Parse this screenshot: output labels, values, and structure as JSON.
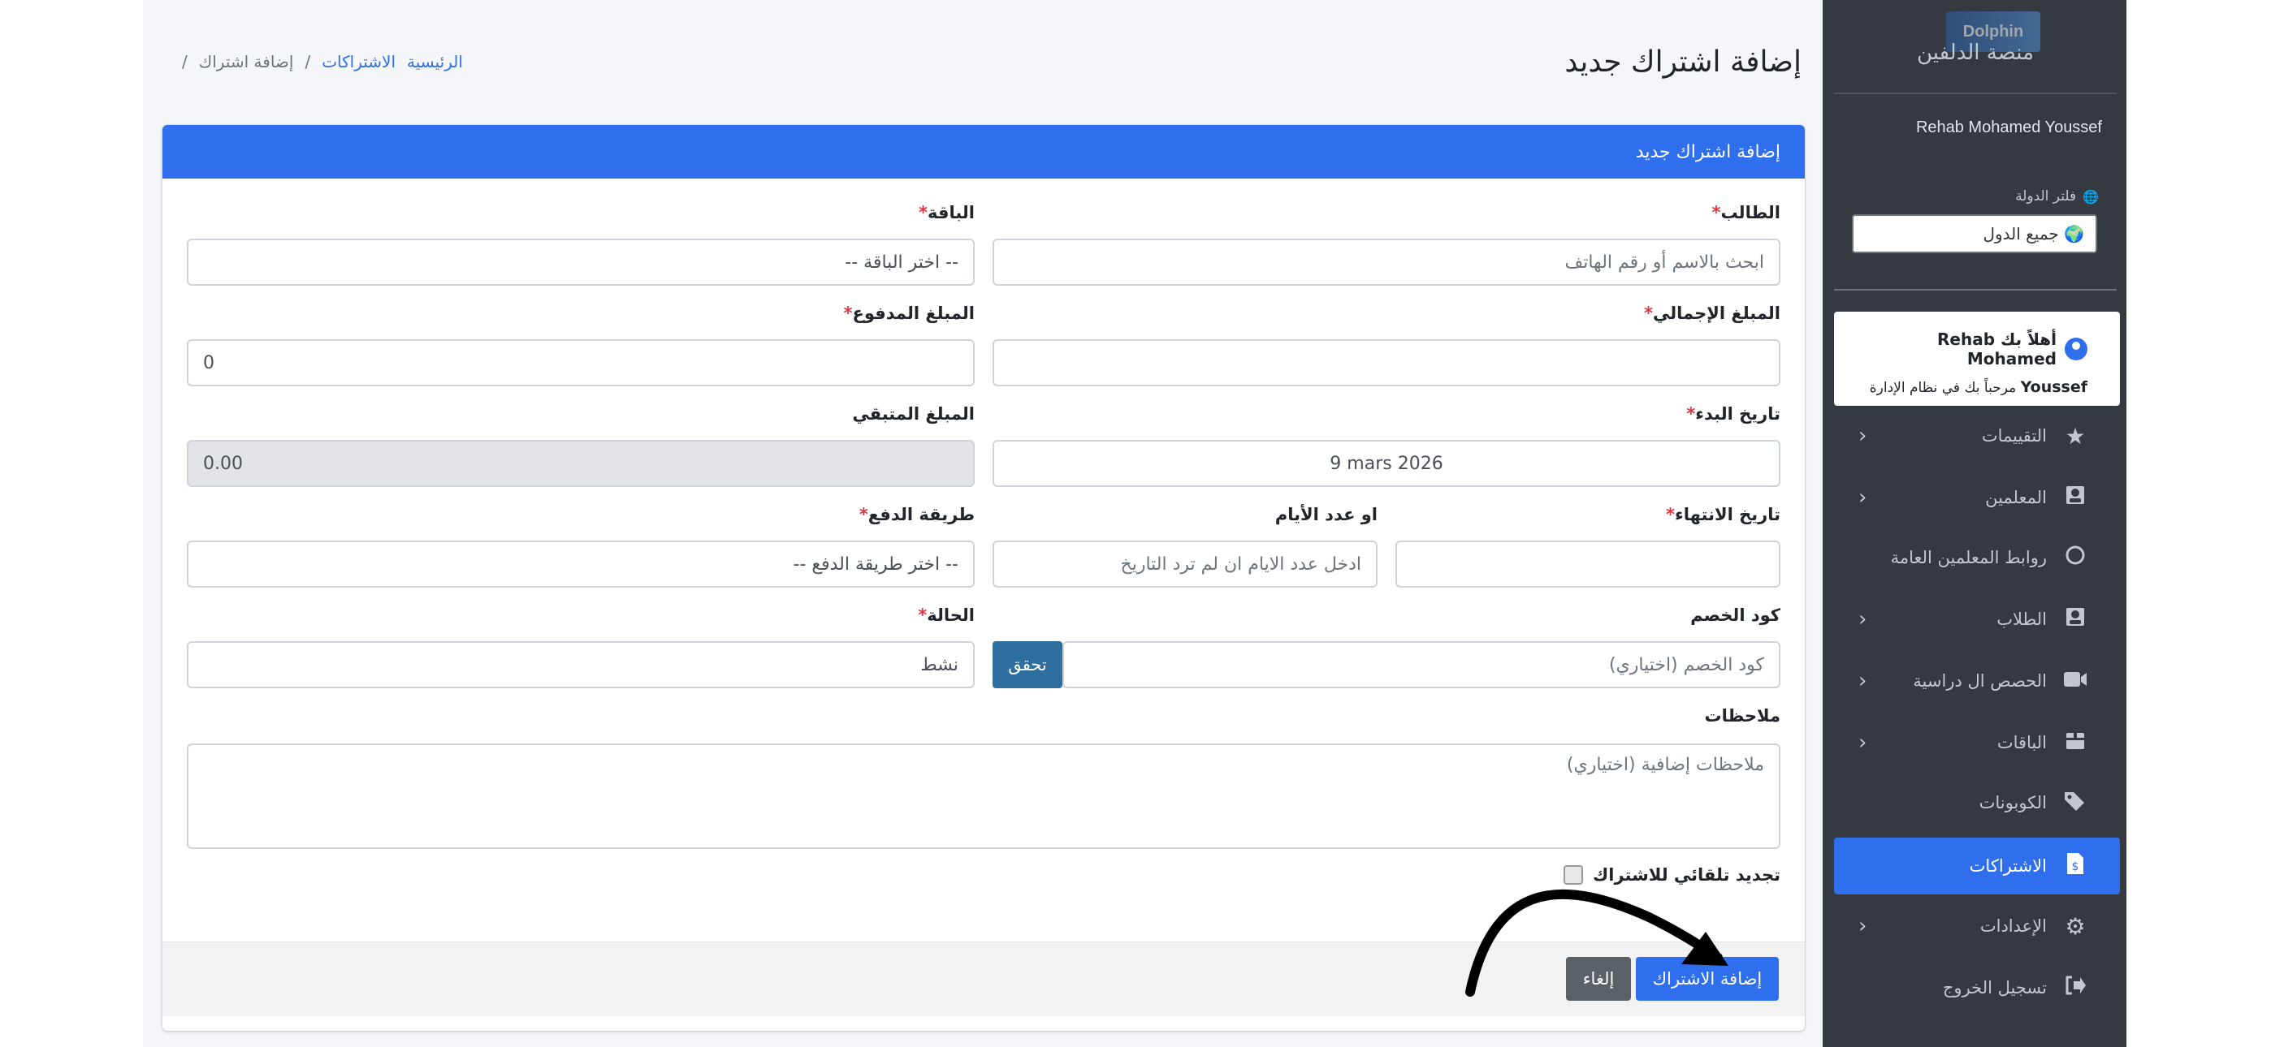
{
  "sidebar": {
    "brand_logo_text": "Dolphin",
    "brand_name": "منصة الدلفين",
    "user_name": "Rehab Mohamed Youssef",
    "country_filter_label": "فلتر الدولة",
    "country_select_value": "🌍 جميع الدول",
    "welcome_title": "أهلاً بك Rehab Mohamed",
    "welcome_name_cont": "Youssef",
    "welcome_subtitle": "مرحباً بك في نظام الإدارة",
    "items": [
      {
        "label": "التقييمات",
        "icon": "star-icon",
        "has_submenu": true,
        "active": false
      },
      {
        "label": "المعلمين",
        "icon": "teacher-icon",
        "has_submenu": true,
        "active": false
      },
      {
        "label": "روابط المعلمين العامة",
        "icon": "circle-icon",
        "has_submenu": false,
        "active": false
      },
      {
        "label": "الطلاب",
        "icon": "student-icon",
        "has_submenu": true,
        "active": false
      },
      {
        "label": "الحصص ال دراسية",
        "icon": "video-icon",
        "has_submenu": true,
        "active": false
      },
      {
        "label": "الباقات",
        "icon": "package-icon",
        "has_submenu": true,
        "active": false
      },
      {
        "label": "الكوبونات",
        "icon": "tags-icon",
        "has_submenu": false,
        "active": false
      },
      {
        "label": "الاشتراكات",
        "icon": "invoice-dollar-icon",
        "has_submenu": false,
        "active": true
      },
      {
        "label": "الإعدادات",
        "icon": "gear-icon",
        "has_submenu": true,
        "active": false
      },
      {
        "label": "تسجيل الخروج",
        "icon": "logout-icon",
        "has_submenu": false,
        "active": false
      }
    ]
  },
  "header": {
    "page_title": "إضافة اشتراك جديد",
    "breadcrumb": {
      "home": "الرئيسية",
      "subscriptions": "الاشتراكات",
      "current": "إضافة اشتراك",
      "sep": "/"
    }
  },
  "form": {
    "card_title": "إضافة اشتراك جديد",
    "required_mark": "*",
    "student": {
      "label": "الطالب",
      "placeholder": "ابحث بالاسم أو رقم الهاتف"
    },
    "package": {
      "label": "الباقة",
      "value": "-- اختر الباقة --"
    },
    "total_amount": {
      "label": "المبلغ الإجمالي",
      "value": ""
    },
    "paid_amount": {
      "label": "المبلغ المدفوع",
      "value": "0"
    },
    "start_date": {
      "label": "تاريخ البدء",
      "value": "9 mars 2026"
    },
    "remaining_amount": {
      "label": "المبلغ المتبقي",
      "value": "0.00"
    },
    "end_date": {
      "label": "تاريخ الانتهاء",
      "value": ""
    },
    "days_count": {
      "label": "او عدد الأيام",
      "placeholder": "ادخل عدد الايام ان لم ترد التاريخ"
    },
    "payment_method": {
      "label": "طريقة الدفع",
      "value": "-- اختر طريقة الدفع --"
    },
    "discount_code": {
      "label": "كود الخصم",
      "placeholder": "كود الخصم (اختياري)",
      "verify_button": "تحقق"
    },
    "status": {
      "label": "الحالة",
      "value": "نشط"
    },
    "notes": {
      "label": "ملاحظات",
      "placeholder": "ملاحظات إضافية (اختياري)"
    },
    "auto_renew": {
      "label": "تجديد تلقائي للاشتراك",
      "checked": false
    },
    "submit_button": "إضافة الاشتراك",
    "cancel_button": "إلغاء"
  },
  "colors": {
    "primary": "#2f6fed",
    "sidebar_bg": "#343a40",
    "content_bg": "#f4f6f9",
    "danger": "#dc3545",
    "secondary": "#5a6268"
  }
}
